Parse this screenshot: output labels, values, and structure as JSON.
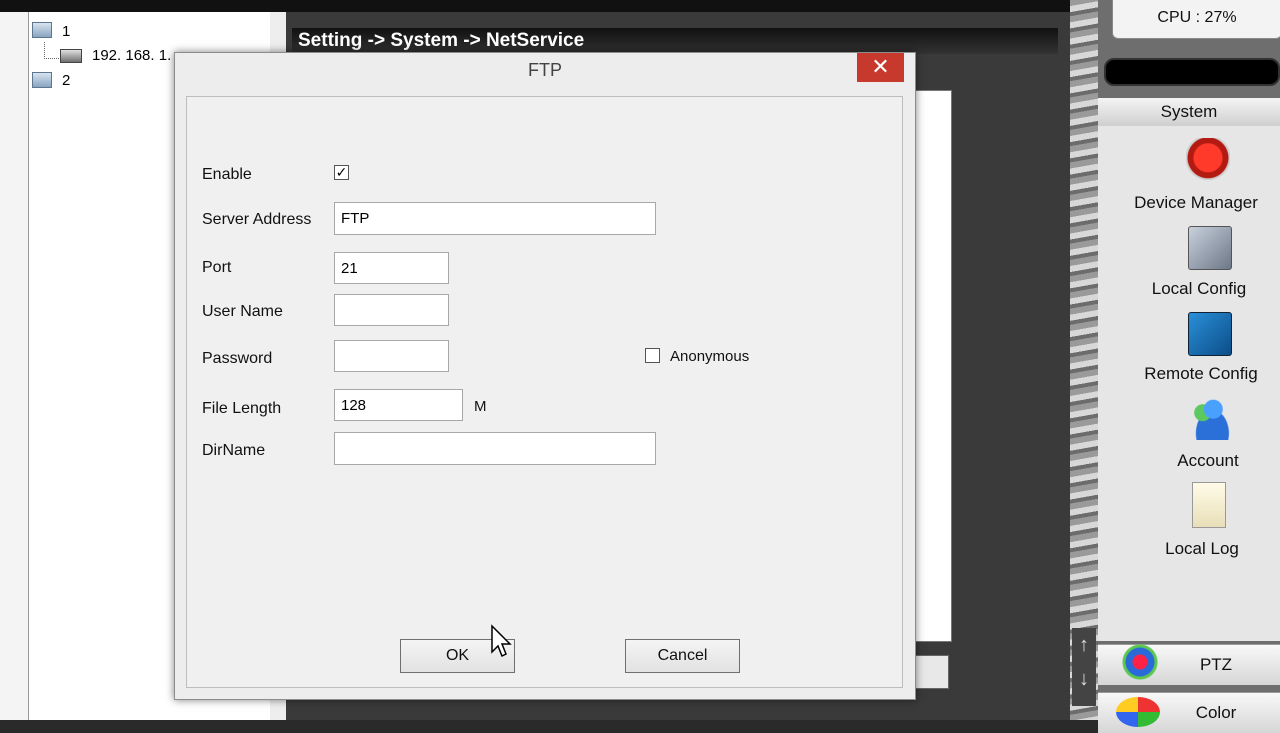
{
  "app": {
    "breadcrumb": "Setting -> System -> NetService",
    "cpu": "CPU : 27%"
  },
  "tree": {
    "nodes": [
      {
        "label": "1"
      },
      {
        "label": "192. 168. 1."
      },
      {
        "label": "2"
      }
    ]
  },
  "system_panel": {
    "header": "System",
    "items": [
      {
        "label": "Device Manager",
        "icon": "device-manager-icon"
      },
      {
        "label": "Local Config",
        "icon": "local-config-icon"
      },
      {
        "label": "Remote Config",
        "icon": "remote-config-icon"
      },
      {
        "label": "Account",
        "icon": "account-icon"
      },
      {
        "label": "Local Log",
        "icon": "local-log-icon"
      }
    ]
  },
  "bottom_tabs": [
    {
      "label": "PTZ"
    },
    {
      "label": "Color"
    }
  ],
  "scroll_arrows": {
    "up": "↑",
    "down": "↓"
  },
  "dialog": {
    "title": "FTP",
    "close_glyph": "✕",
    "fields": {
      "enable_label": "Enable",
      "enable_checked": true,
      "check_glyph": "✓",
      "server_label": "Server Address",
      "server_value": "FTP",
      "port_label": "Port",
      "port_value": "21",
      "user_label": "User Name",
      "user_value": "",
      "password_label": "Password",
      "password_value": "",
      "anonymous_label": "Anonymous",
      "anonymous_checked": false,
      "file_length_label": "File Length",
      "file_length_value": "128",
      "file_length_unit": "M",
      "dirname_label": "DirName",
      "dirname_value": ""
    },
    "ok_label": "OK",
    "cancel_label": "Cancel"
  }
}
